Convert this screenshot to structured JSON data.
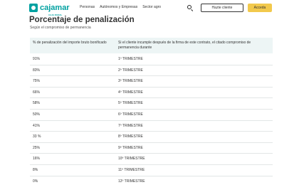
{
  "header": {
    "logo_text": "cajamar",
    "logo_sub": "CAJA RURAL",
    "nav": [
      "Personas",
      "Autónomos y Empresas",
      "Sector agro"
    ],
    "client_button": "Hazte cliente",
    "access_button": "Acceda",
    "accent_color": "#00a1a1",
    "access_color": "#f2c94c"
  },
  "page": {
    "title": "Porcentaje de penalización",
    "subtitle": "Según el compromiso de permanencia"
  },
  "table": {
    "headers": [
      "% de penalización del importe bruto bonificado",
      "Si el cliente incumple después de la firma de este contrato, el citado compromiso de permanencia durante"
    ],
    "rows": [
      [
        "91%",
        "1º TRIMESTRE"
      ],
      [
        "83%",
        "2º TRIMESTRE"
      ],
      [
        "75%",
        "3º TRIMESTRE"
      ],
      [
        "66%",
        "4º TRIMESTRE"
      ],
      [
        "58%",
        "5º TRIMESTRE"
      ],
      [
        "50%",
        "6º TRIMESTRE"
      ],
      [
        "41%",
        "7º TRIMESTRE"
      ],
      [
        "33 %",
        "8º TRIMESTRE"
      ],
      [
        "25%",
        "9º TRIMESTRE"
      ],
      [
        "16%",
        "10º TRIMESTRE"
      ],
      [
        "8%",
        "11º TRIMESTRE"
      ],
      [
        "0%",
        "12º TRIMESTRE"
      ]
    ]
  }
}
